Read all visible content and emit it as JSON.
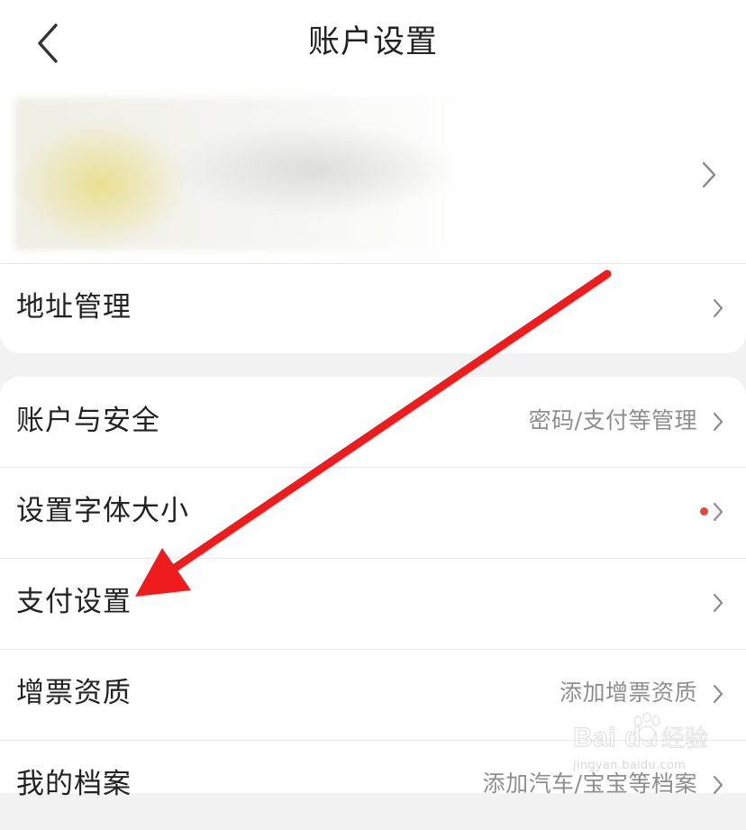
{
  "header": {
    "title": "账户设置",
    "back_icon": "chevron-left-icon"
  },
  "profile": {
    "chevron_icon": "chevron-right-icon"
  },
  "rows": [
    {
      "label": "地址管理",
      "value": ""
    },
    {
      "label": "账户与安全",
      "value": "密码/支付等管理"
    },
    {
      "label": "设置字体大小",
      "value": "",
      "has_red_dot": true
    },
    {
      "label": "支付设置",
      "value": ""
    },
    {
      "label": "增票资质",
      "value": "添加增票资质"
    },
    {
      "label": "我的档案",
      "value": "添加汽车/宝宝等档案"
    }
  ],
  "annotation": {
    "arrow_color": "#ee1c1c"
  },
  "watermark": {
    "brand": "Bai du",
    "suffix": "经验",
    "url": "jingyan.baidu.com"
  },
  "colors": {
    "background": "#f2f2f2",
    "card": "#ffffff",
    "text": "#222222",
    "secondary_text": "#8e8e8e",
    "chevron": "#8c8c8c",
    "red_dot": "#e8453c"
  }
}
